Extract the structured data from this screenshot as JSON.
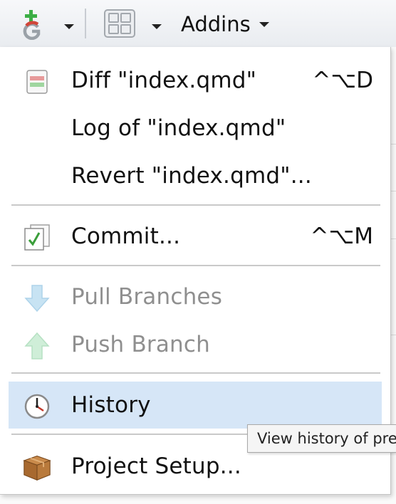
{
  "toolbar": {
    "git_icon": "git-add-icon",
    "pane_icon": "pane-layout-icon",
    "addins_label": "Addins"
  },
  "menu": {
    "items": [
      {
        "label": "Diff \"index.qmd\"",
        "shortcut": "^⌥D",
        "icon": "diff-icon"
      },
      {
        "label": "Log of \"index.qmd\""
      },
      {
        "label": "Revert \"index.qmd\"..."
      },
      {
        "label": "Commit...",
        "shortcut": "^⌥M",
        "icon": "commit-checkmark-icon"
      },
      {
        "label": "Pull Branches",
        "icon": "pull-arrow-down-icon",
        "disabled": true
      },
      {
        "label": "Push Branch",
        "icon": "push-arrow-up-icon",
        "disabled": true
      },
      {
        "label": "History",
        "icon": "clock-icon",
        "highlighted": true
      },
      {
        "label": "Project Setup...",
        "icon": "package-box-icon"
      }
    ]
  },
  "tooltip": {
    "text": "View history of previous commits"
  },
  "colors": {
    "highlight": "#d6e6f7",
    "disabled_text": "#8f8f8f",
    "separator": "#c9c9c9"
  }
}
